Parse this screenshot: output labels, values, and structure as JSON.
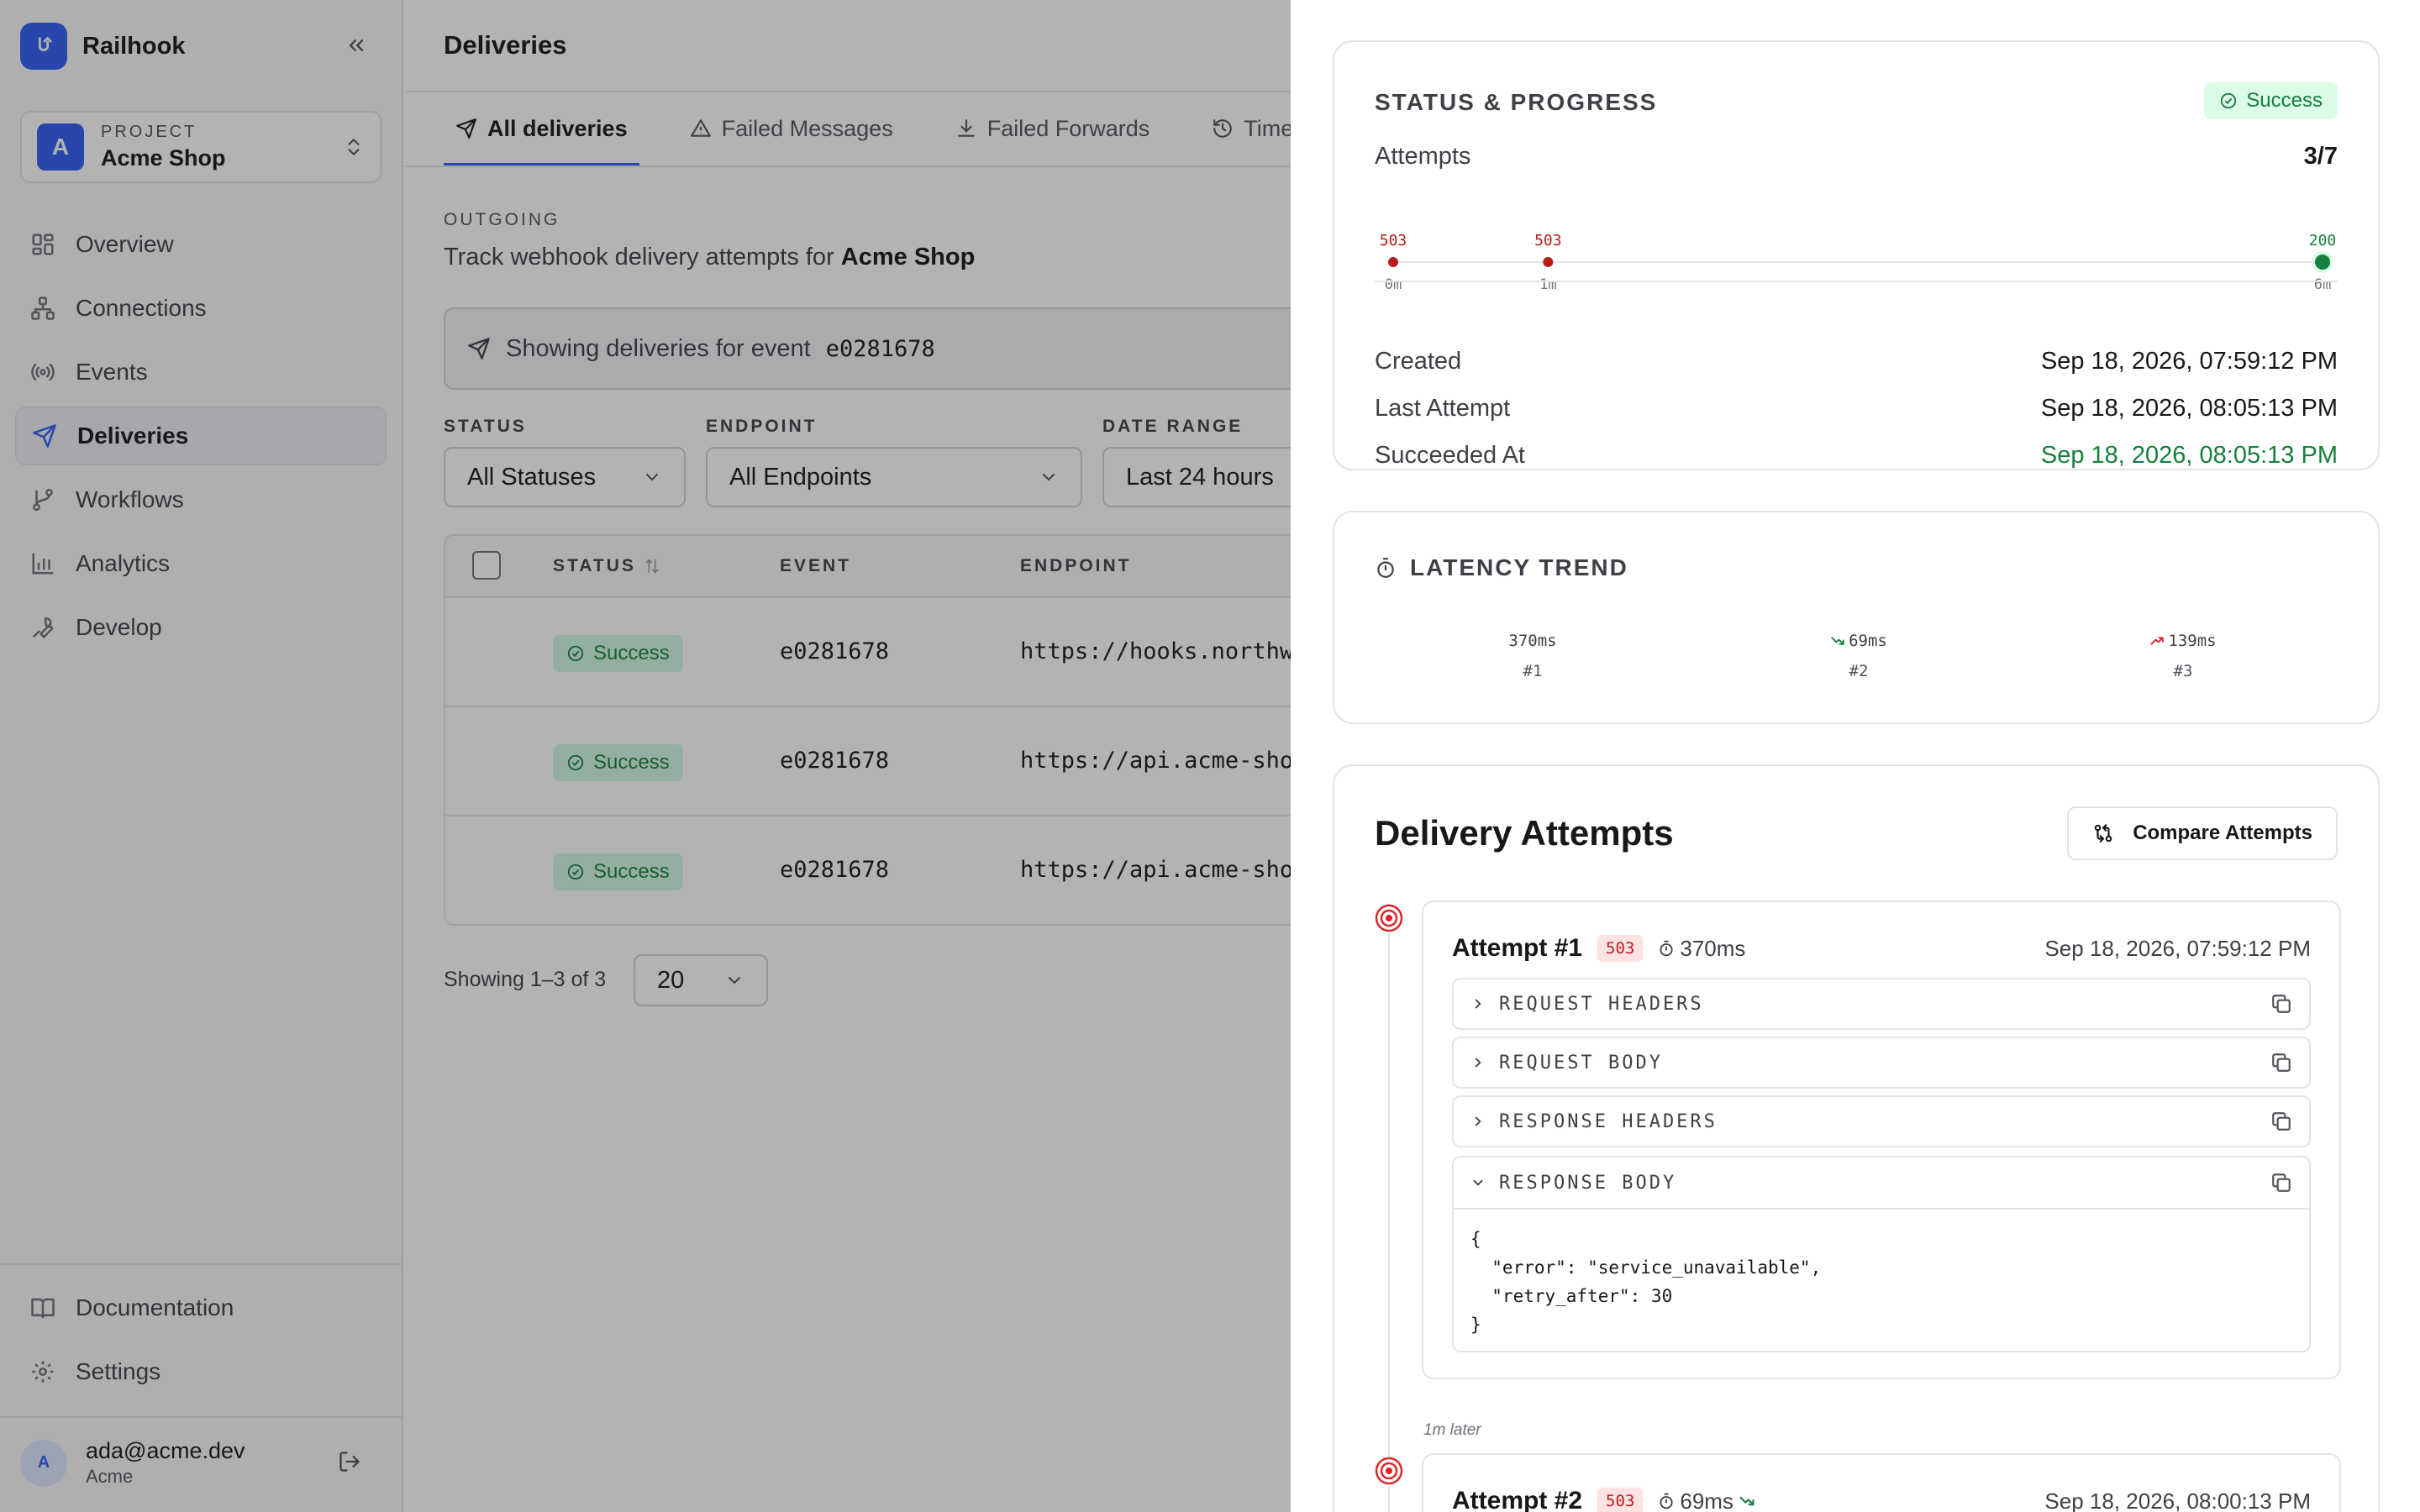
{
  "app": {
    "name": "Railhook",
    "logo_glyph": "↺"
  },
  "sidebar": {
    "project_label": "PROJECT",
    "project_name": "Acme Shop",
    "project_initial": "A",
    "nav": [
      {
        "label": "Overview",
        "icon": "grid-icon"
      },
      {
        "label": "Connections",
        "icon": "network-icon"
      },
      {
        "label": "Events",
        "icon": "broadcast-icon"
      },
      {
        "label": "Deliveries",
        "icon": "send-icon",
        "active": true
      },
      {
        "label": "Workflows",
        "icon": "git-branch-icon"
      },
      {
        "label": "Analytics",
        "icon": "bar-chart-icon"
      },
      {
        "label": "Develop",
        "icon": "wrench-icon"
      }
    ],
    "footer_nav": [
      {
        "label": "Documentation",
        "icon": "book-icon"
      },
      {
        "label": "Settings",
        "icon": "gear-icon"
      }
    ],
    "user": {
      "initial": "A",
      "email": "ada@acme.dev",
      "org": "Acme"
    }
  },
  "main": {
    "title": "Deliveries",
    "tabs": [
      {
        "label": "All deliveries",
        "active": true
      },
      {
        "label": "Failed Messages"
      },
      {
        "label": "Failed Forwards"
      },
      {
        "label": "Time Machine"
      }
    ],
    "section_label": "OUTGOING",
    "description_prefix": "Track webhook delivery attempts for ",
    "description_project": "Acme Shop",
    "event_banner_prefix": "Showing deliveries for event",
    "event_banner_id": "e0281678",
    "filters": [
      {
        "label": "STATUS",
        "value": "All Statuses"
      },
      {
        "label": "ENDPOINT",
        "value": "All Endpoints"
      },
      {
        "label": "DATE RANGE",
        "value": "Last 24 hours"
      }
    ],
    "table": {
      "columns": [
        "STATUS",
        "EVENT",
        "ENDPOINT"
      ],
      "rows": [
        {
          "status": "Success",
          "event": "e0281678",
          "endpoint": "https://hooks.northwind.io/webhooks"
        },
        {
          "status": "Success",
          "event": "e0281678",
          "endpoint": "https://api.acme-shop.com/webhooks"
        },
        {
          "status": "Success",
          "event": "e0281678",
          "endpoint": "https://api.acme-shop.com/hooks"
        }
      ]
    },
    "pager_text": "Showing 1–3 of 3",
    "page_size": "20"
  },
  "panel": {
    "status_title": "STATUS & PROGRESS",
    "status_badge": "Success",
    "attempts_label": "Attempts",
    "attempts_value": "3/7",
    "timeline": [
      {
        "code": "503",
        "time": "0m",
        "status": "error"
      },
      {
        "code": "503",
        "time": "1m",
        "status": "error"
      },
      {
        "code": "200",
        "time": "6m",
        "status": "success"
      }
    ],
    "timeline_span_minutes": 6,
    "details": [
      {
        "key": "Created",
        "value": "Sep 18, 2026, 07:59:12 PM"
      },
      {
        "key": "Last Attempt",
        "value": "Sep 18, 2026, 08:05:13 PM"
      },
      {
        "key": "Succeeded At",
        "value": "Sep 18, 2026, 08:05:13 PM",
        "color": "#15803d"
      }
    ],
    "latency_title": "LATENCY TREND",
    "latency": [
      {
        "value": "370ms",
        "label": "#1",
        "trend": "none"
      },
      {
        "value": "69ms",
        "label": "#2",
        "trend": "down"
      },
      {
        "value": "139ms",
        "label": "#3",
        "trend": "up"
      }
    ],
    "attempts_title": "Delivery Attempts",
    "compare_label": "Compare Attempts",
    "attempt1": {
      "name": "Attempt #1",
      "code": "503",
      "duration": "370ms",
      "time": "Sep 18, 2026, 07:59:12 PM",
      "sections": [
        "REQUEST HEADERS",
        "REQUEST BODY",
        "RESPONSE HEADERS"
      ],
      "response_body_label": "RESPONSE BODY",
      "response_body": "{\n  \"error\": \"service_unavailable\",\n  \"retry_after\": 30\n}"
    },
    "gap_label": "1m later",
    "attempt2": {
      "name": "Attempt #2",
      "code": "503",
      "duration": "69ms",
      "time": "Sep 18, 2026, 08:00:13 PM"
    }
  },
  "colors": {
    "accent": "#2f5ff5",
    "success": "#15803d",
    "error": "#b91c1c"
  }
}
